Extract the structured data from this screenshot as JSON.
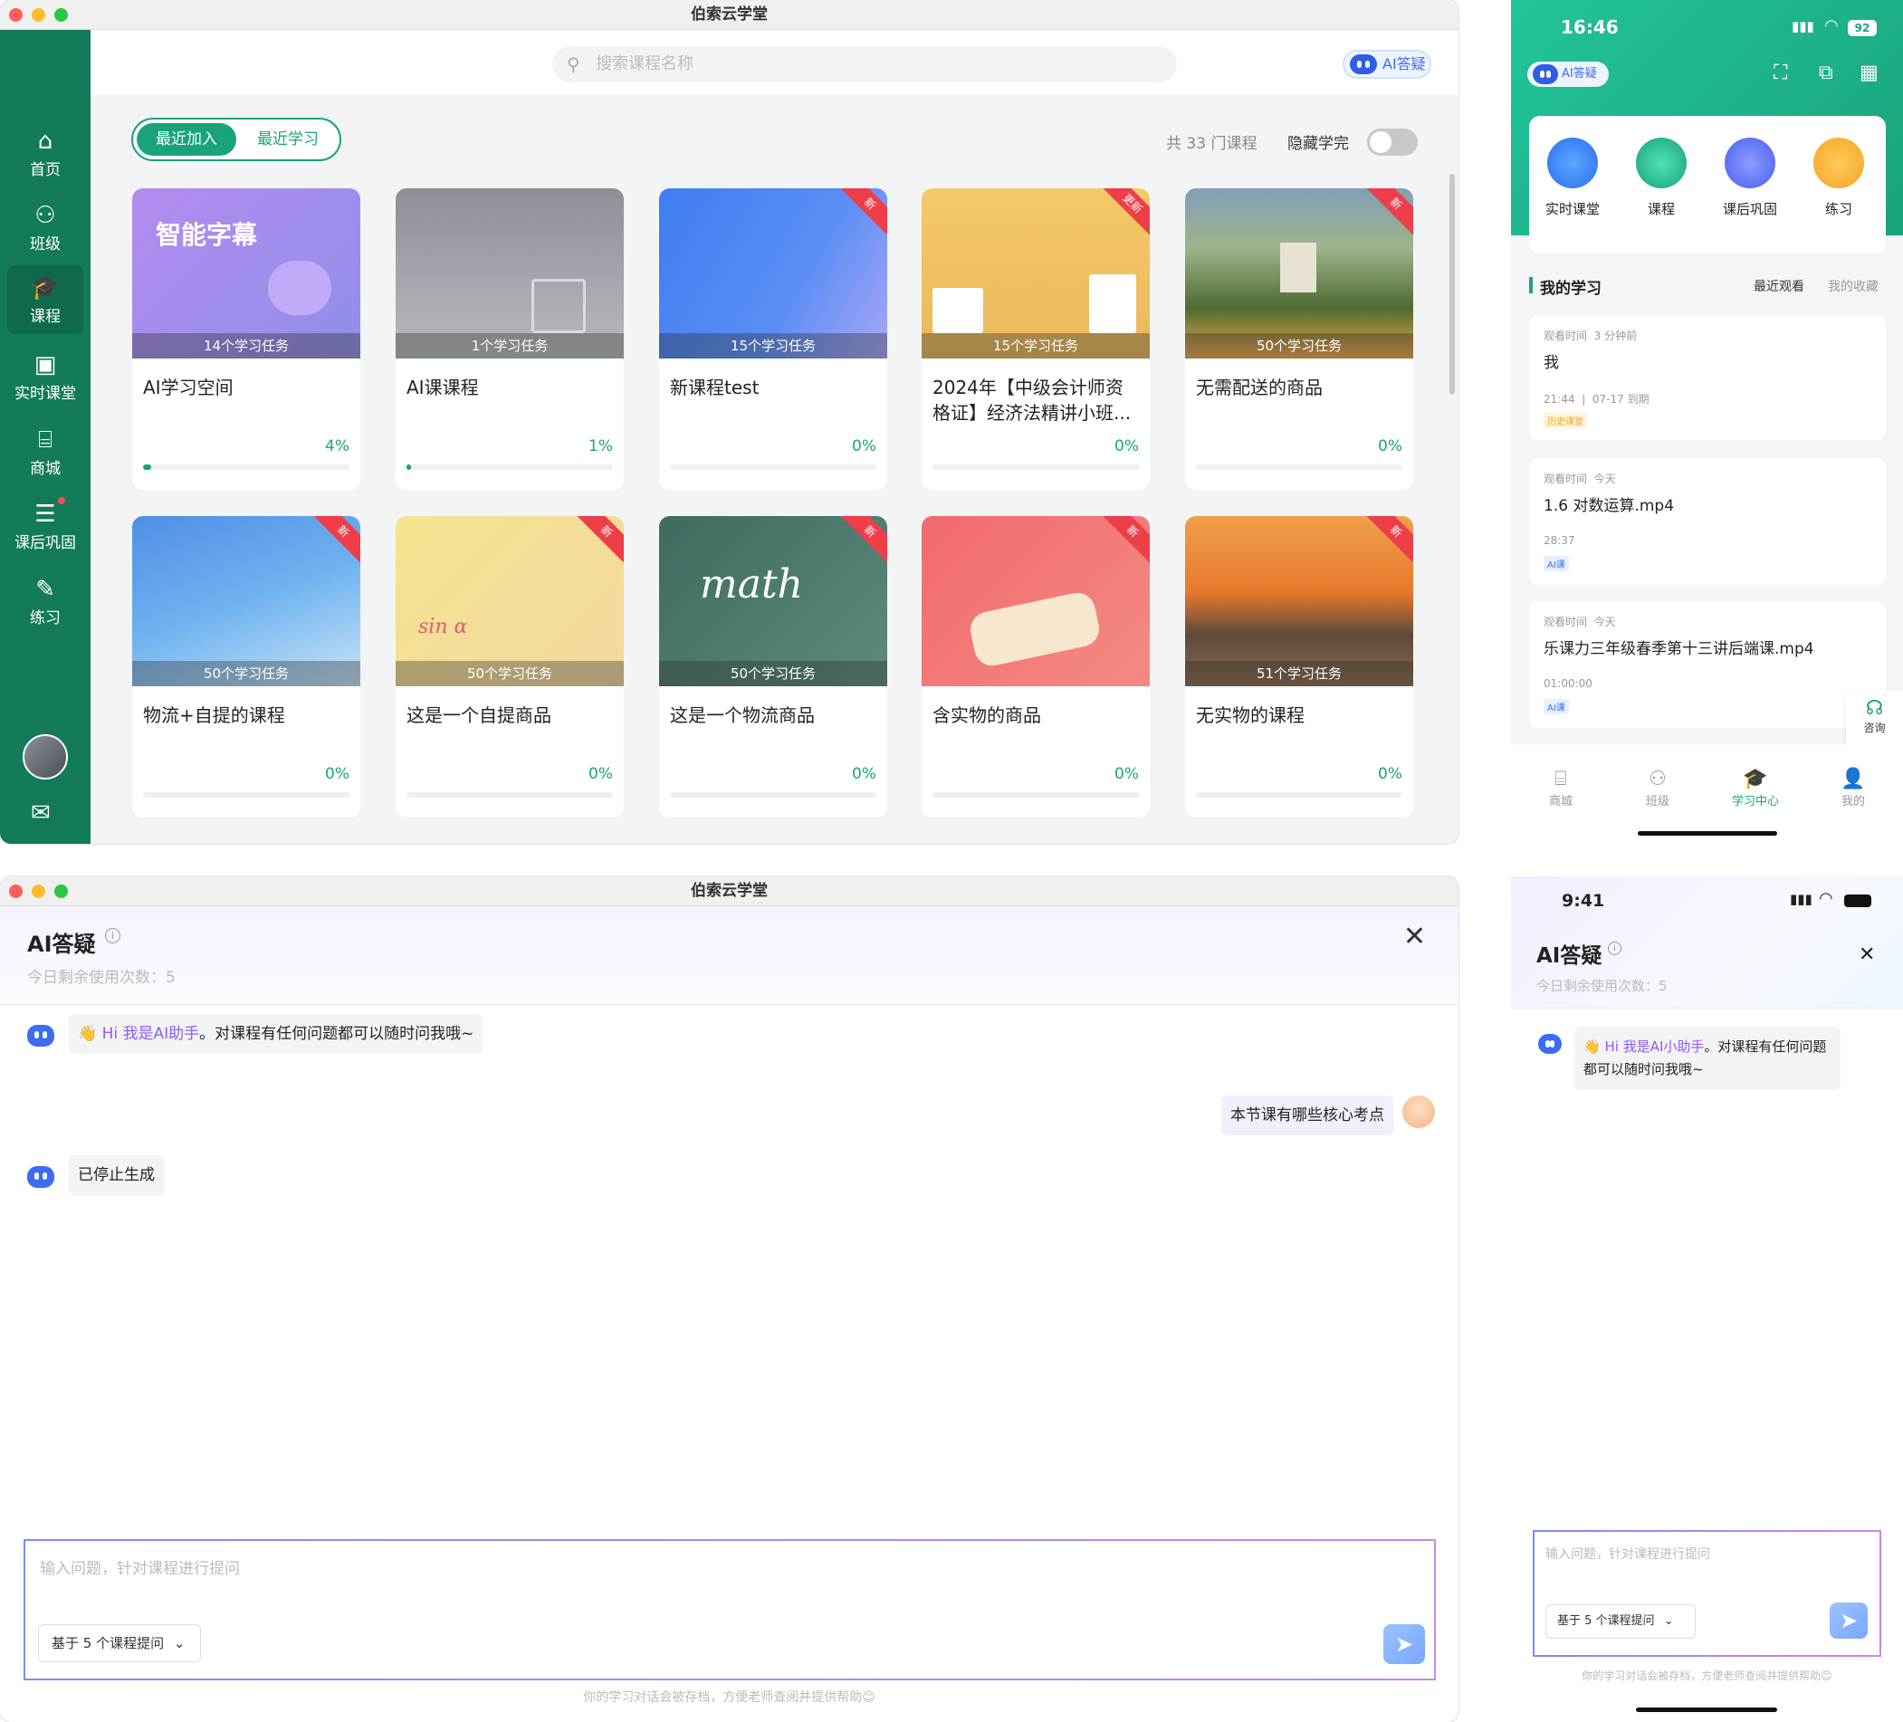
{
  "desktop": {
    "window_title": "伯索云学堂",
    "search_placeholder": "搜索课程名称",
    "ai_button": "AI答疑",
    "sidebar": [
      {
        "label": "首页",
        "icon": "home-icon"
      },
      {
        "label": "班级",
        "icon": "class-icon"
      },
      {
        "label": "课程",
        "icon": "course-icon"
      },
      {
        "label": "实时课堂",
        "icon": "live-class-icon"
      },
      {
        "label": "商城",
        "icon": "shop-icon"
      },
      {
        "label": "课后巩固",
        "icon": "review-icon"
      },
      {
        "label": "练习",
        "icon": "practice-icon"
      }
    ],
    "tabs": [
      "最近加入",
      "最近学习"
    ],
    "course_count": "共 33 门课程",
    "hide_completed": "隐藏学完",
    "thumb_text": "智能字幕",
    "ribbon_new": "新",
    "ribbon_update": "更新",
    "courses": [
      {
        "title": "AI学习空间",
        "tasks": "14个学习任务",
        "pct": "4%",
        "progress": 0.04
      },
      {
        "title": "AI课课程",
        "tasks": "1个学习任务",
        "pct": "1%",
        "progress": 0.01
      },
      {
        "title": "新课程test",
        "tasks": "15个学习任务",
        "pct": "0%",
        "progress": 0
      },
      {
        "title": "2024年【中级会计师资格证】经济法精讲小班...",
        "tasks": "15个学习任务",
        "pct": "0%",
        "progress": 0
      },
      {
        "title": "无需配送的商品",
        "tasks": "50个学习任务",
        "pct": "0%",
        "progress": 0
      },
      {
        "title": "物流+自提的课程",
        "tasks": "50个学习任务",
        "pct": "0%",
        "progress": 0
      },
      {
        "title": "这是一个自提商品",
        "tasks": "50个学习任务",
        "pct": "0%",
        "progress": 0
      },
      {
        "title": "这是一个物流商品",
        "tasks": "50个学习任务",
        "pct": "0%",
        "progress": 0
      },
      {
        "title": "含实物的商品",
        "tasks": "",
        "pct": "0%",
        "progress": 0
      },
      {
        "title": "无实物的课程",
        "tasks": "51个学习任务",
        "pct": "0%",
        "progress": 0
      }
    ]
  },
  "phone1": {
    "time": "16:46",
    "battery": "92",
    "ai_badge": "AI答疑",
    "quick": [
      "实时课堂",
      "课程",
      "课后巩固",
      "练习"
    ],
    "section_title": "我的学习",
    "section_tabs": [
      "最近观看",
      "我的收藏"
    ],
    "items": [
      {
        "meta_label": "观看时间",
        "meta_value": "3 分钟前",
        "title": "我",
        "time": "21:44",
        "date": "07-17 到期",
        "tag": "历史课堂"
      },
      {
        "meta_label": "观看时间",
        "meta_value": "今天",
        "title": "1.6 对数运算.mp4",
        "time": "28:37",
        "tag": "AI课"
      },
      {
        "meta_label": "观看时间",
        "meta_value": "今天",
        "title": "乐课力三年级春季第十三讲后端课.mp4",
        "time": "01:00:00",
        "tag": "AI课"
      }
    ],
    "consult": "咨询",
    "tabbar": [
      "商城",
      "班级",
      "学习中心",
      "我的"
    ]
  },
  "ai_desktop": {
    "window_title": "伯索云学堂",
    "title": "AI答疑",
    "remaining": "今日剩余使用次数：5",
    "greeting_hi": "Hi 我是AI助手",
    "greeting_rest": "。对课程有任何问题都可以随时问我哦~",
    "user_msg": "本节课有哪些核心考点",
    "stopped": "已停止生成",
    "input_placeholder": "输入问题，针对课程进行提问",
    "select_label": "基于 5 个课程提问",
    "footer": "你的学习对话会被存档，方便老师查阅并提供帮助😊"
  },
  "ai_phone": {
    "time": "9:41",
    "title": "AI答疑",
    "remaining": "今日剩余使用次数：5",
    "greeting_hi": "Hi 我是AI小助手",
    "greeting_rest": "。对课程有任何问题都可以随时问我哦~",
    "input_placeholder": "输入问题，针对课程进行提问",
    "select_label": "基于 5 个课程提问",
    "footer": "你的学习对话会被存档，方便老师查阅并提供帮助😊"
  }
}
